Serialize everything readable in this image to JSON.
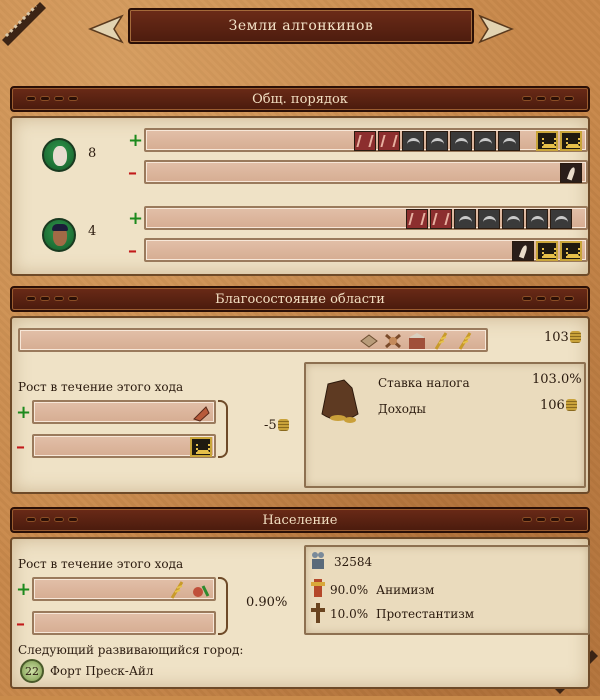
{
  "window": {
    "title": "Земли алгонкинов"
  },
  "order": {
    "header": "Общ. порядок",
    "rows": [
      {
        "portrait": "elder-portrait",
        "value": "8"
      },
      {
        "portrait": "warrior-portrait",
        "value": "4"
      }
    ]
  },
  "wealth": {
    "header": "Благосостояние области",
    "total": "103",
    "growth_label": "Рост в течение этого хода",
    "growth_value": "-5",
    "tax_label": "Ставка налога",
    "tax_value": "103.0%",
    "income_label": "Доходы",
    "income_value": "106"
  },
  "population": {
    "header": "Население",
    "growth_label": "Рост в течение этого хода",
    "growth_value": "0.90%",
    "count": "32584",
    "religions": [
      {
        "pct": "90.0%",
        "name": "Анимизм"
      },
      {
        "pct": "10.0%",
        "name": "Протестантизм"
      }
    ],
    "next_city_label": "Следующий развивающийся город:",
    "next_city_level": "22",
    "next_city_name": "Форт Преск-Айл"
  },
  "colors": {
    "positive": "#1d8a1d",
    "negative": "#c21a1a",
    "header_bg": "#5a2212",
    "parchment": "#efe2c6"
  }
}
